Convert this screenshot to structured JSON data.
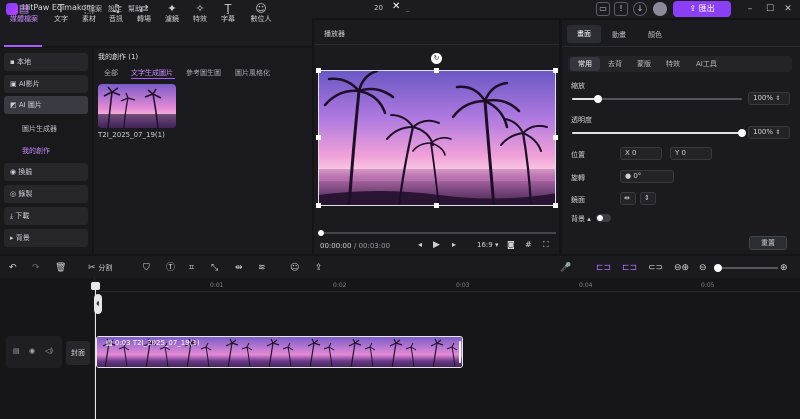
{
  "app": {
    "name": "HitPaw Edimakor",
    "menu": [
      "檔案",
      "設定",
      "幫助"
    ],
    "window_title": "20",
    "export_label": "匯出"
  },
  "toolbar": [
    {
      "label": "媒體檔案",
      "icon": "folder-icon",
      "active": true
    },
    {
      "label": "文字",
      "icon": "text-icon"
    },
    {
      "label": "素材",
      "icon": "sticker-icon"
    },
    {
      "label": "音訊",
      "icon": "music-icon"
    },
    {
      "label": "轉場",
      "icon": "transition-icon"
    },
    {
      "label": "濾鏡",
      "icon": "filter-icon"
    },
    {
      "label": "特效",
      "icon": "effects-icon"
    },
    {
      "label": "字幕",
      "icon": "subtitle-icon"
    },
    {
      "label": "數位人",
      "icon": "avatar-icon"
    }
  ],
  "sidebar": {
    "items": [
      {
        "label": "本地",
        "icon": "folder-icon"
      },
      {
        "label": "AI影片",
        "icon": "ai-video-icon"
      },
      {
        "label": "AI 圖片",
        "icon": "ai-image-icon",
        "highlighted": true
      },
      {
        "label": "換臉",
        "icon": "face-swap-icon"
      },
      {
        "label": "錄製",
        "icon": "record-icon"
      },
      {
        "label": "下載",
        "icon": "download-icon"
      },
      {
        "label": "背景",
        "icon": "background-icon"
      }
    ],
    "subitems": [
      {
        "label": "圖片生成器"
      },
      {
        "label": "我的創作",
        "active": true
      }
    ]
  },
  "media": {
    "section_title": "我的創作 (1)",
    "tabs": [
      "全部",
      "文字生成圖片",
      "參考圖生圖",
      "圖片風格化"
    ],
    "active_tab": 1,
    "items": [
      {
        "caption": "T2I_2025_07_19(1)"
      }
    ]
  },
  "player": {
    "title": "播放器",
    "current_time": "00:00:00",
    "total_time": "/ 00:03:00",
    "aspect": "16:9"
  },
  "properties": {
    "tabs": [
      "畫面",
      "動畫",
      "顏色"
    ],
    "active_tab": 0,
    "subtabs": [
      "常用",
      "去背",
      "蒙版",
      "特效",
      "AI工具"
    ],
    "active_subtab": 0,
    "zoom_label": "縮放",
    "zoom_value": "100%",
    "zoom_level": 0.15,
    "opacity_label": "透明度",
    "opacity_value": "100%",
    "opacity_level": 1.0,
    "position_label": "位置",
    "x_label": "X",
    "x_value": "0",
    "y_label": "Y",
    "y_value": "0",
    "rotation_label": "旋轉",
    "rotation_value": "0°",
    "mirror_label": "鏡面",
    "background_label": "背景",
    "reset_label": "重置"
  },
  "timeline": {
    "split_label": "分割",
    "ruler": [
      "0",
      "0:01",
      "0:02",
      "0:03",
      "0:04",
      "0:05"
    ],
    "cover_label": "封面",
    "clip_label": "0:03 T2I_2025_07_19(1)"
  }
}
